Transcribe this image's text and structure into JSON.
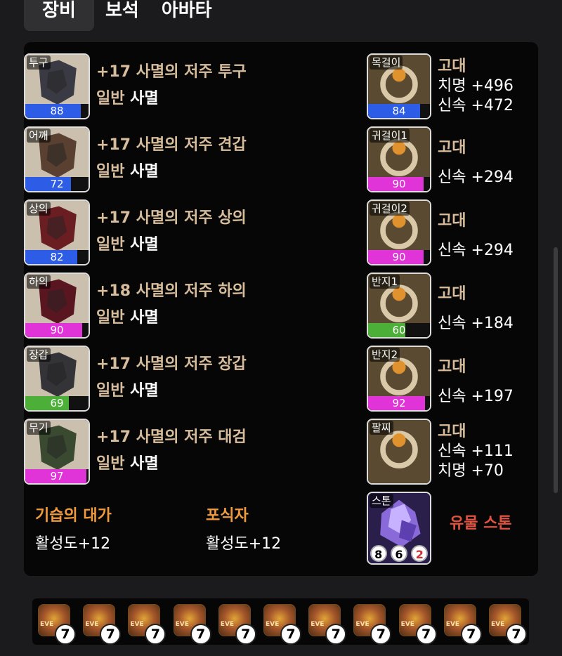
{
  "tabs": [
    {
      "label": "장비",
      "active": true
    },
    {
      "label": "보석",
      "active": false
    },
    {
      "label": "아바타",
      "active": false
    }
  ],
  "equipment": [
    {
      "slot": "투구",
      "name": "+17 사멸의 저주 투구",
      "grade": "일반",
      "set": "사멸",
      "quality": 88,
      "quality_color": "#2d5de6"
    },
    {
      "slot": "어깨",
      "name": "+17 사멸의 저주 견갑",
      "grade": "일반",
      "set": "사멸",
      "quality": 72,
      "quality_color": "#2d5de6"
    },
    {
      "slot": "상의",
      "name": "+17 사멸의 저주 상의",
      "grade": "일반",
      "set": "사멸",
      "quality": 82,
      "quality_color": "#2d5de6"
    },
    {
      "slot": "하의",
      "name": "+18 사멸의 저주 하의",
      "grade": "일반",
      "set": "사멸",
      "quality": 90,
      "quality_color": "#e033d8"
    },
    {
      "slot": "장갑",
      "name": "+17 사멸의 저주 장갑",
      "grade": "일반",
      "set": "사멸",
      "quality": 69,
      "quality_color": "#4caf38"
    },
    {
      "slot": "무기",
      "name": "+17 사멸의 저주 대검",
      "grade": "일반",
      "set": "사멸",
      "quality": 97,
      "quality_color": "#e033d8"
    }
  ],
  "accessories": [
    {
      "slot": "목걸이",
      "grade": "고대",
      "stats": [
        "치명 +496",
        "신속 +472"
      ],
      "quality": 84,
      "quality_color": "#2d5de6"
    },
    {
      "slot": "귀걸이1",
      "grade": "고대",
      "stats": [
        "신속 +294"
      ],
      "quality": 90,
      "quality_color": "#e033d8"
    },
    {
      "slot": "귀걸이2",
      "grade": "고대",
      "stats": [
        "신속 +294"
      ],
      "quality": 90,
      "quality_color": "#e033d8"
    },
    {
      "slot": "반지1",
      "grade": "고대",
      "stats": [
        "신속 +184"
      ],
      "quality": 60,
      "quality_color": "#4caf38"
    },
    {
      "slot": "반지2",
      "grade": "고대",
      "stats": [
        "신속 +197"
      ],
      "quality": 92,
      "quality_color": "#e033d8"
    },
    {
      "slot": "팔찌",
      "grade": "고대",
      "stats": [
        "신속 +111",
        "치명 +70"
      ],
      "quality": null,
      "quality_color": null
    }
  ],
  "engravings": [
    {
      "name": "기습의 대가",
      "value": "활성도+12"
    },
    {
      "name": "포식자",
      "value": "활성도+12"
    }
  ],
  "stone": {
    "slot": "스톤",
    "label": "유물 스톤",
    "levels": [
      "8",
      "6",
      "2"
    ],
    "level_colors": [
      "#000000",
      "#000000",
      "#d03030"
    ]
  },
  "gems": [
    {
      "level": "7",
      "text": "EVE"
    },
    {
      "level": "7",
      "text": "EVE"
    },
    {
      "level": "7",
      "text": "EVE"
    },
    {
      "level": "7",
      "text": "EVE"
    },
    {
      "level": "7",
      "text": "EVE"
    },
    {
      "level": "7",
      "text": "EVE"
    },
    {
      "level": "7",
      "text": "EVE"
    },
    {
      "level": "7",
      "text": "EVE"
    },
    {
      "level": "7",
      "text": "EVE"
    },
    {
      "level": "7",
      "text": "EVE"
    },
    {
      "level": "7",
      "text": "EVE"
    }
  ]
}
